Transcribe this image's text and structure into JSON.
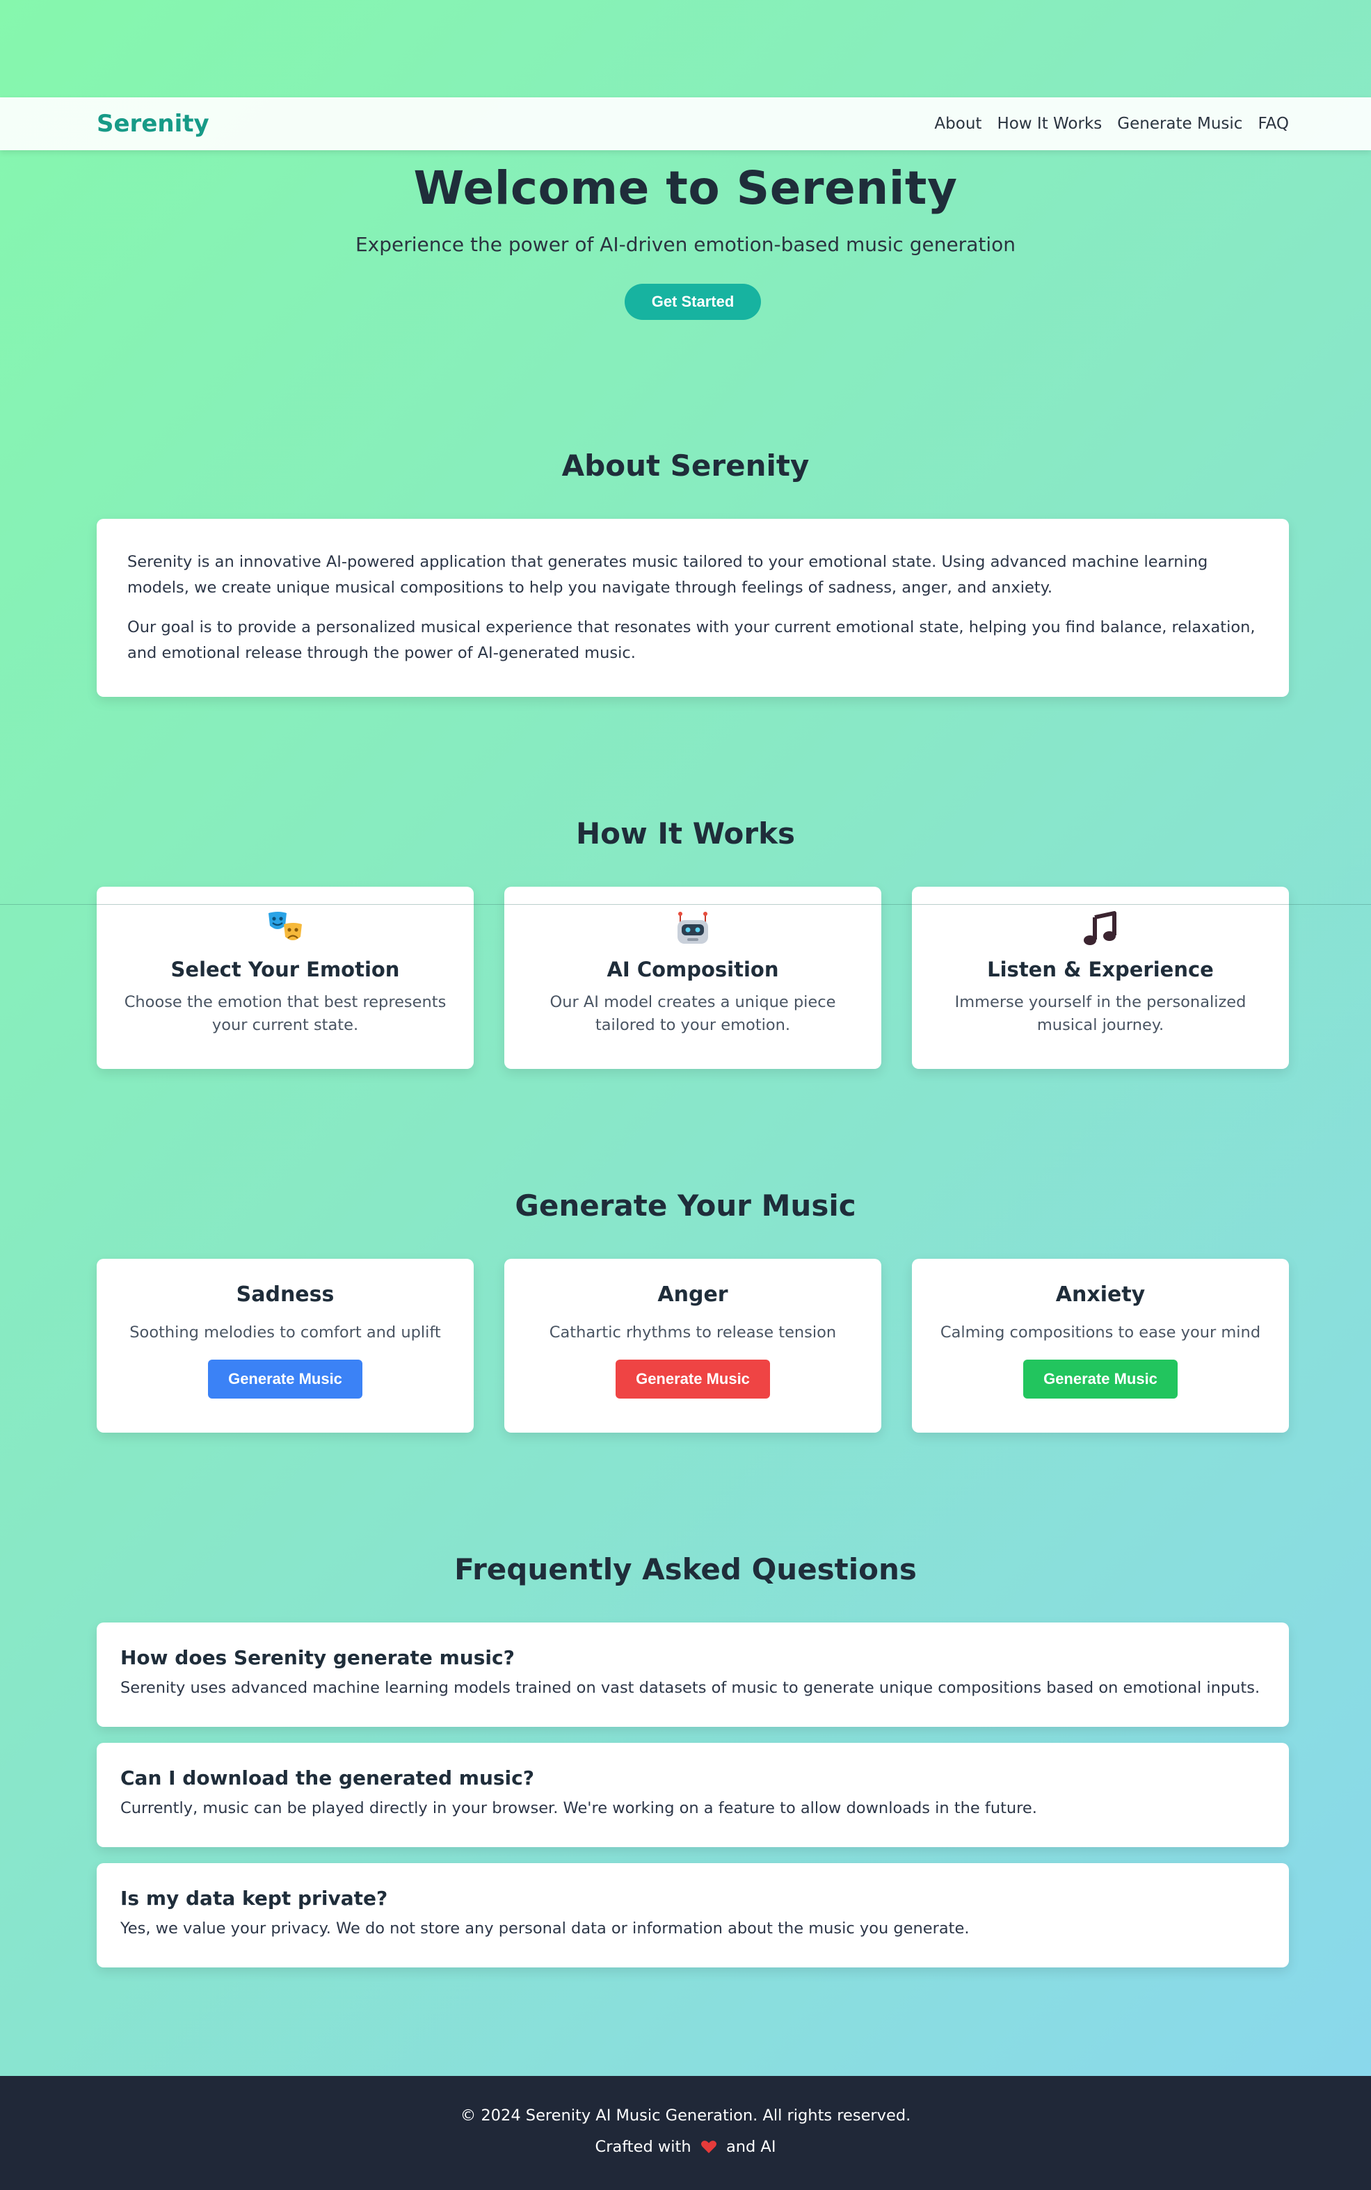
{
  "nav": {
    "brand": "Serenity",
    "links": [
      {
        "label": "About"
      },
      {
        "label": "How It Works"
      },
      {
        "label": "Generate Music"
      },
      {
        "label": "FAQ"
      }
    ]
  },
  "hero": {
    "title": "Welcome to Serenity",
    "subtitle": "Experience the power of AI-driven emotion-based music generation",
    "cta": "Get Started"
  },
  "about": {
    "title": "About Serenity",
    "paragraphs": [
      "Serenity is an innovative AI-powered application that generates music tailored to your emotional state. Using advanced machine learning models, we create unique musical compositions to help you navigate through feelings of sadness, anger, and anxiety.",
      "Our goal is to provide a personalized musical experience that resonates with your current emotional state, helping you find balance, relaxation, and emotional release through the power of AI-generated music."
    ]
  },
  "how": {
    "title": "How It Works",
    "steps": [
      {
        "icon": "theater-masks-icon",
        "title": "Select Your Emotion",
        "desc": "Choose the emotion that best represents your current state."
      },
      {
        "icon": "robot-icon",
        "title": "AI Composition",
        "desc": "Our AI model creates a unique piece tailored to your emotion."
      },
      {
        "icon": "music-note-icon",
        "title": "Listen & Experience",
        "desc": "Immerse yourself in the personalized musical journey."
      }
    ]
  },
  "generate": {
    "title": "Generate Your Music",
    "cards": [
      {
        "title": "Sadness",
        "desc": "Soothing melodies to comfort and uplift",
        "button": "Generate Music",
        "color": "#3b82f6"
      },
      {
        "title": "Anger",
        "desc": "Cathartic rhythms to release tension",
        "button": "Generate Music",
        "color": "#ef4444"
      },
      {
        "title": "Anxiety",
        "desc": "Calming compositions to ease your mind",
        "button": "Generate Music",
        "color": "#22c55e"
      }
    ]
  },
  "faq": {
    "title": "Frequently Asked Questions",
    "items": [
      {
        "q": "How does Serenity generate music?",
        "a": "Serenity uses advanced machine learning models trained on vast datasets of music to generate unique compositions based on emotional inputs."
      },
      {
        "q": "Can I download the generated music?",
        "a": "Currently, music can be played directly in your browser. We're working on a feature to allow downloads in the future."
      },
      {
        "q": "Is my data kept private?",
        "a": "Yes, we value your privacy. We do not store any personal data or information about the music you generate."
      }
    ]
  },
  "footer": {
    "copyright": "© 2024 Serenity AI Music Generation. All rights reserved.",
    "crafted_prefix": "Crafted with",
    "crafted_suffix": "and AI",
    "heart_icon": "heart-icon"
  },
  "colors": {
    "brand": "#179a87",
    "cta": "#17b3a0",
    "footer_bg": "#202838"
  }
}
